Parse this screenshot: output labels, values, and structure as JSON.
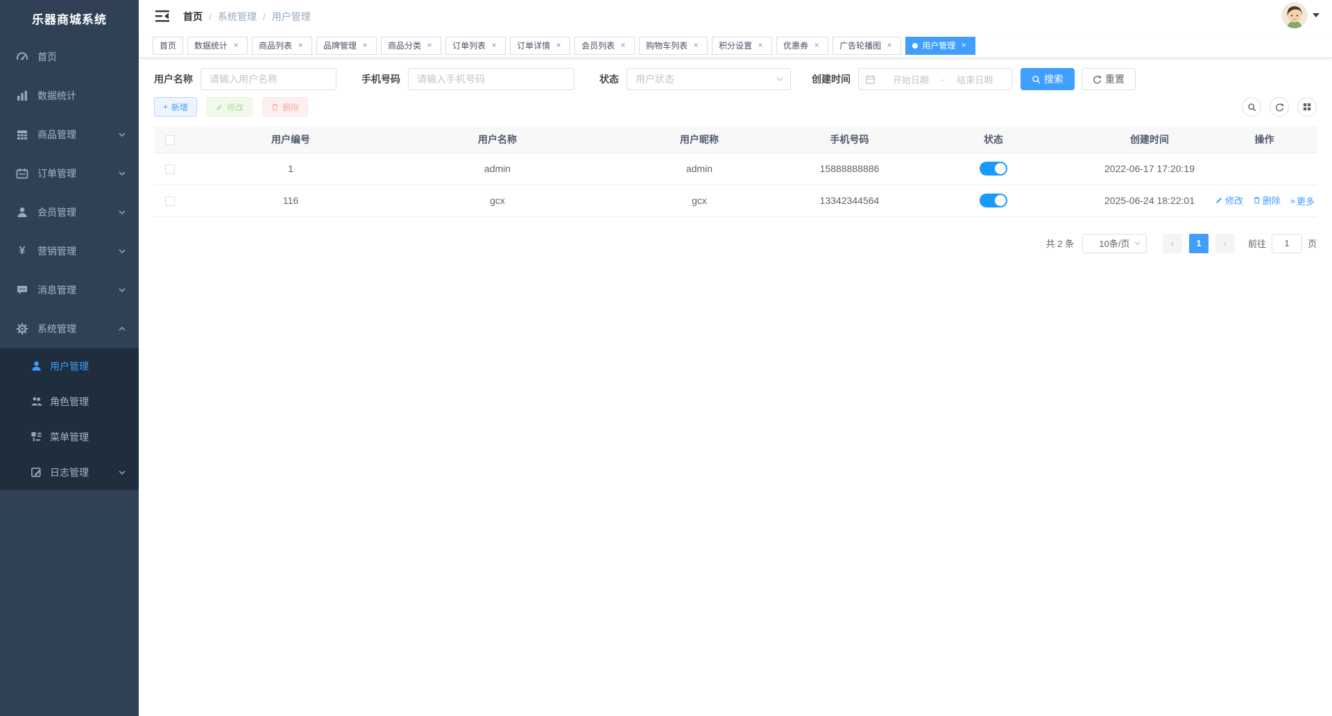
{
  "accent_color": "#409EFF",
  "sidebar_bg": "#304156",
  "submenu_bg": "#1f2d3d",
  "sidebar": {
    "title": "乐器商城系统",
    "items": [
      {
        "icon": "dashboard-icon",
        "label": "首页",
        "expandable": false
      },
      {
        "icon": "bar-chart-icon",
        "label": "数据统计",
        "expandable": false
      },
      {
        "icon": "grid-icon",
        "label": "商品管理",
        "expandable": true
      },
      {
        "icon": "order-icon",
        "label": "订单管理",
        "expandable": true
      },
      {
        "icon": "user-icon",
        "label": "会员管理",
        "expandable": true
      },
      {
        "icon": "yen-icon",
        "label": "营销管理",
        "expandable": true
      },
      {
        "icon": "message-icon",
        "label": "消息管理",
        "expandable": true
      },
      {
        "icon": "gear-icon",
        "label": "系统管理",
        "expandable": true,
        "expanded": true
      }
    ],
    "submenu": [
      {
        "icon": "user-icon",
        "label": "用户管理",
        "active": true
      },
      {
        "icon": "users-icon",
        "label": "角色管理",
        "active": false
      },
      {
        "icon": "menu-tree-icon",
        "label": "菜单管理",
        "active": false
      },
      {
        "icon": "log-icon",
        "label": "日志管理",
        "active": false,
        "expandable": true
      }
    ]
  },
  "header": {
    "breadcrumb": {
      "items": [
        "首页",
        "系统管理",
        "用户管理"
      ],
      "separator": "/"
    }
  },
  "tabs": {
    "items": [
      {
        "label": "首页",
        "closable": false,
        "active": false
      },
      {
        "label": "数据统计",
        "closable": true,
        "active": false
      },
      {
        "label": "商品列表",
        "closable": true,
        "active": false
      },
      {
        "label": "品牌管理",
        "closable": true,
        "active": false
      },
      {
        "label": "商品分类",
        "closable": true,
        "active": false
      },
      {
        "label": "订单列表",
        "closable": true,
        "active": false
      },
      {
        "label": "订单详情",
        "closable": true,
        "active": false
      },
      {
        "label": "会员列表",
        "closable": true,
        "active": false
      },
      {
        "label": "购物车列表",
        "closable": true,
        "active": false
      },
      {
        "label": "积分设置",
        "closable": true,
        "active": false
      },
      {
        "label": "优惠券",
        "closable": true,
        "active": false
      },
      {
        "label": "广告轮播图",
        "closable": true,
        "active": false
      },
      {
        "label": "用户管理",
        "closable": true,
        "active": true
      }
    ]
  },
  "icons": {
    "close": "×",
    "prev": "‹",
    "next": "›",
    "more": "»",
    "plus": "+"
  },
  "search": {
    "username_label": "用户名称",
    "username_placeholder": "请输入用户名称",
    "phone_label": "手机号码",
    "phone_placeholder": "请输入手机号码",
    "status_label": "状态",
    "status_placeholder": "用户状态",
    "created_label": "创建时间",
    "date_start_placeholder": "开始日期",
    "date_separator": "-",
    "date_end_placeholder": "结束日期",
    "search_button": "搜索",
    "reset_button": "重置"
  },
  "toolbar": {
    "add_label": "新增",
    "edit_label": "修改",
    "delete_label": "删除"
  },
  "table": {
    "columns": {
      "id": "用户编号",
      "name": "用户名称",
      "nick": "用户昵称",
      "phone": "手机号码",
      "status": "状态",
      "created": "创建时间",
      "ops": "操作"
    },
    "rows": [
      {
        "id": "1",
        "name": "admin",
        "nick": "admin",
        "phone": "15888888886",
        "status_on": true,
        "created": "2022-06-17 17:20:19"
      },
      {
        "id": "116",
        "name": "gcx",
        "nick": "gcx",
        "phone": "13342344564",
        "status_on": true,
        "created": "2025-06-24 18:22:01",
        "ops": {
          "edit": "修改",
          "delete": "删除",
          "more": "更多"
        }
      }
    ]
  },
  "pagination": {
    "total_text": "共 2 条",
    "page_size_text": "10条/页",
    "current_page": "1",
    "goto_label": "前往",
    "goto_value": "1",
    "page_suffix": "页"
  }
}
